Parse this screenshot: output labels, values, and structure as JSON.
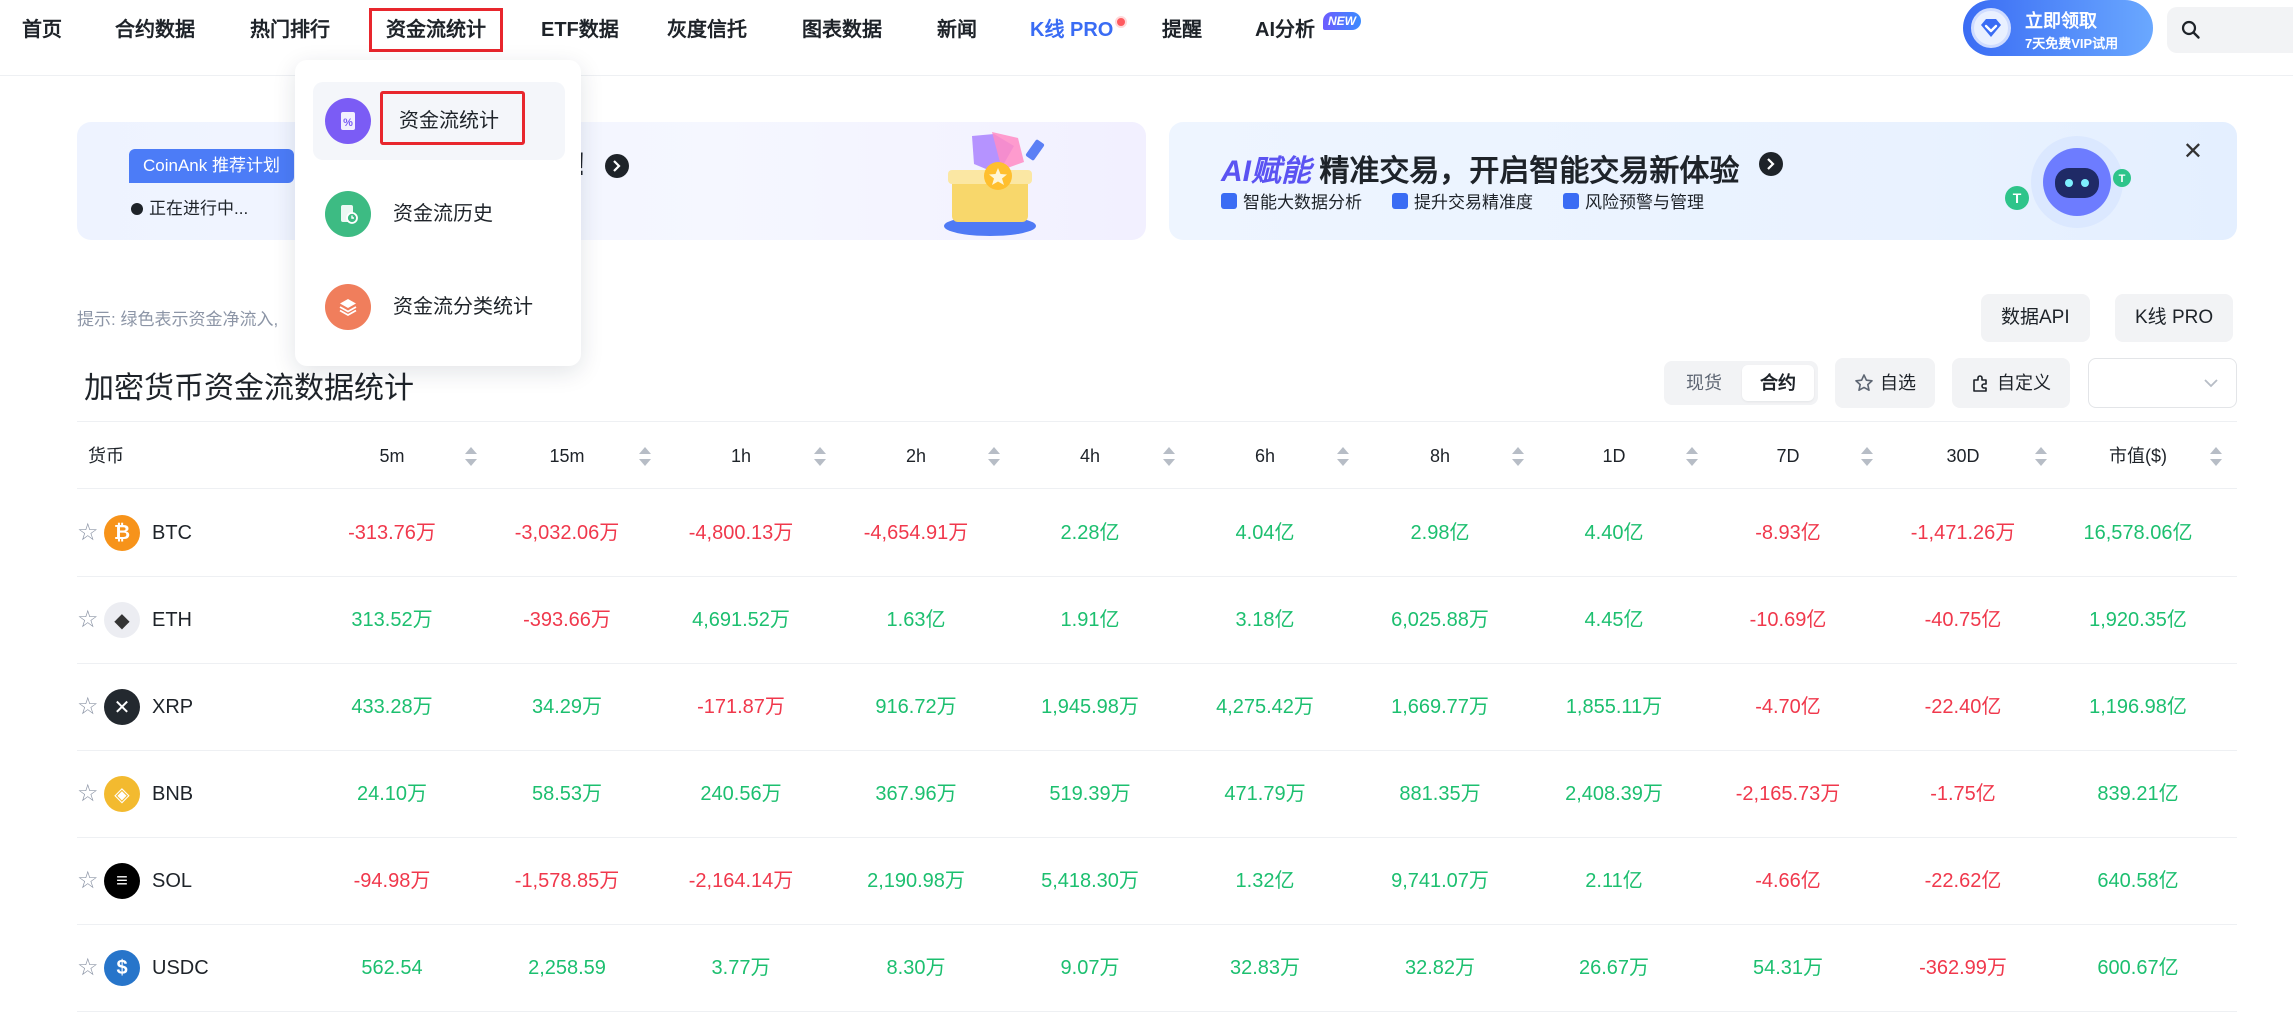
{
  "nav": {
    "items": [
      "首页",
      "合约数据",
      "热门排行",
      "资金流统计",
      "ETF数据",
      "灰度信托",
      "图表数据",
      "新闻",
      "K线 PRO",
      "提醒",
      "AI分析"
    ],
    "new_badge": "NEW",
    "vip_title": "立即领取",
    "vip_sub": "7天免费VIP试用"
  },
  "dropdown": {
    "items": [
      "资金流统计",
      "资金流历史",
      "资金流分类统计"
    ],
    "icon_colors": [
      "#7b5cf5",
      "#3dbb83",
      "#f07e5c"
    ]
  },
  "banner_left": {
    "tag": "CoinAnk 推荐计划",
    "status": "正在进行中...",
    "headline_tail": "!"
  },
  "banner_right": {
    "headline_ai": "AI赋能",
    "headline_rest": " 精准交易，开启智能交易新体验",
    "features": [
      "智能大数据分析",
      "提升交易精准度",
      "风险预警与管理"
    ]
  },
  "hint": "提示: 绿色表示资金净流入,",
  "buttons": {
    "data_api": "数据API",
    "kline_pro": "K线 PRO",
    "favorites": "自选",
    "custom": "自定义"
  },
  "title": "加密货币资金流数据统计",
  "segment": {
    "spot": "现货",
    "contract": "合约"
  },
  "table": {
    "coin_header": "货币",
    "columns": [
      "5m",
      "15m",
      "1h",
      "2h",
      "4h",
      "6h",
      "8h",
      "1D",
      "7D",
      "30D",
      "市值($)"
    ],
    "rows": [
      {
        "symbol": "BTC",
        "logo_color": "#f7931a",
        "logo_text": "₿",
        "values": [
          "-313.76万",
          "-3,032.06万",
          "-4,800.13万",
          "-4,654.91万",
          "2.28亿",
          "4.04亿",
          "2.98亿",
          "4.40亿",
          "-8.93亿",
          "-1,471.26万",
          "16,578.06亿"
        ]
      },
      {
        "symbol": "ETH",
        "logo_color": "#ecedf2",
        "logo_text": "◆",
        "values": [
          "313.52万",
          "-393.66万",
          "4,691.52万",
          "1.63亿",
          "1.91亿",
          "3.18亿",
          "6,025.88万",
          "4.45亿",
          "-10.69亿",
          "-40.75亿",
          "1,920.35亿"
        ]
      },
      {
        "symbol": "XRP",
        "logo_color": "#23292f",
        "logo_text": "✕",
        "values": [
          "433.28万",
          "34.29万",
          "-171.87万",
          "916.72万",
          "1,945.98万",
          "4,275.42万",
          "1,669.77万",
          "1,855.11万",
          "-4.70亿",
          "-22.40亿",
          "1,196.98亿"
        ]
      },
      {
        "symbol": "BNB",
        "logo_color": "#f3ba2f",
        "logo_text": "◈",
        "values": [
          "24.10万",
          "58.53万",
          "240.56万",
          "367.96万",
          "519.39万",
          "471.79万",
          "881.35万",
          "2,408.39万",
          "-2,165.73万",
          "-1.75亿",
          "839.21亿"
        ]
      },
      {
        "symbol": "SOL",
        "logo_color": "#000000",
        "logo_text": "≡",
        "values": [
          "-94.98万",
          "-1,578.85万",
          "-2,164.14万",
          "2,190.98万",
          "5,418.30万",
          "1.32亿",
          "9,741.07万",
          "2.11亿",
          "-4.66亿",
          "-22.62亿",
          "640.58亿"
        ]
      },
      {
        "symbol": "USDC",
        "logo_color": "#2775ca",
        "logo_text": "$",
        "values": [
          "562.54",
          "2,258.59",
          "3.77万",
          "8.30万",
          "9.07万",
          "32.83万",
          "32.82万",
          "26.67万",
          "54.31万",
          "-362.99万",
          "600.67亿"
        ]
      }
    ]
  }
}
